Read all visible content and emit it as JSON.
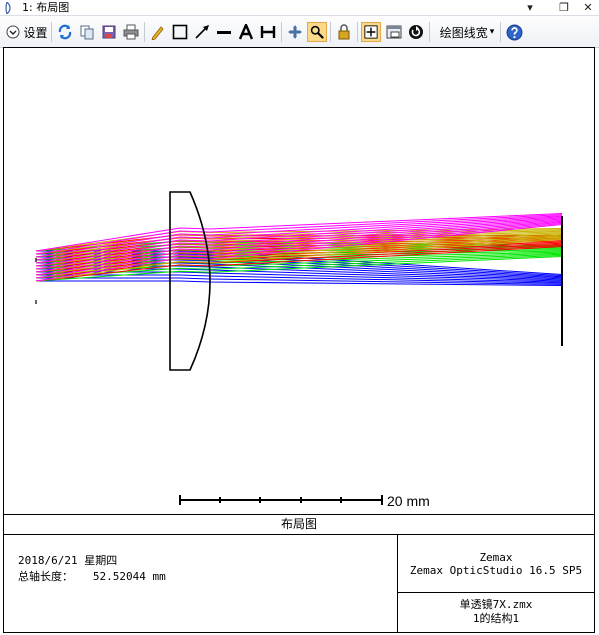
{
  "window": {
    "title": "1: 布局图",
    "controls": {
      "menu": "▾",
      "restore": "❐",
      "close": "✕"
    }
  },
  "toolbar": {
    "settings_label": "设置",
    "linewidth_label": "绘图线宽",
    "linewidth_caret": "▾",
    "items": [
      "settings-dropdown",
      "refresh-icon",
      "copy-icon",
      "save-icon",
      "print-icon",
      "pencil-icon",
      "rectangle-icon",
      "arrow-icon",
      "line-icon",
      "text-icon",
      "dimension-icon",
      "pan-icon",
      "zoom-icon",
      "lock-icon",
      "fit-icon",
      "window-icon",
      "auto-update-icon",
      "linewidth-dropdown",
      "help-icon"
    ],
    "active_item": "zoom-icon"
  },
  "plot": {
    "scale_bar_label": "20 mm",
    "caption": "布局图",
    "colors": {
      "field1": "#0000ff",
      "field2": "#00e600",
      "field3": "#ff0000",
      "field4": "#c8b400",
      "field5": "#ff00ff",
      "lens": "#000000"
    }
  },
  "info": {
    "date_line": "2018/6/21 星期四",
    "length_line": "总轴长度：   52.52044 mm",
    "product_name": "Zemax",
    "product_version": "Zemax OpticStudio 16.5 SP5",
    "file_name": "单透镜7X.zmx",
    "config_line": "1的结构1"
  }
}
